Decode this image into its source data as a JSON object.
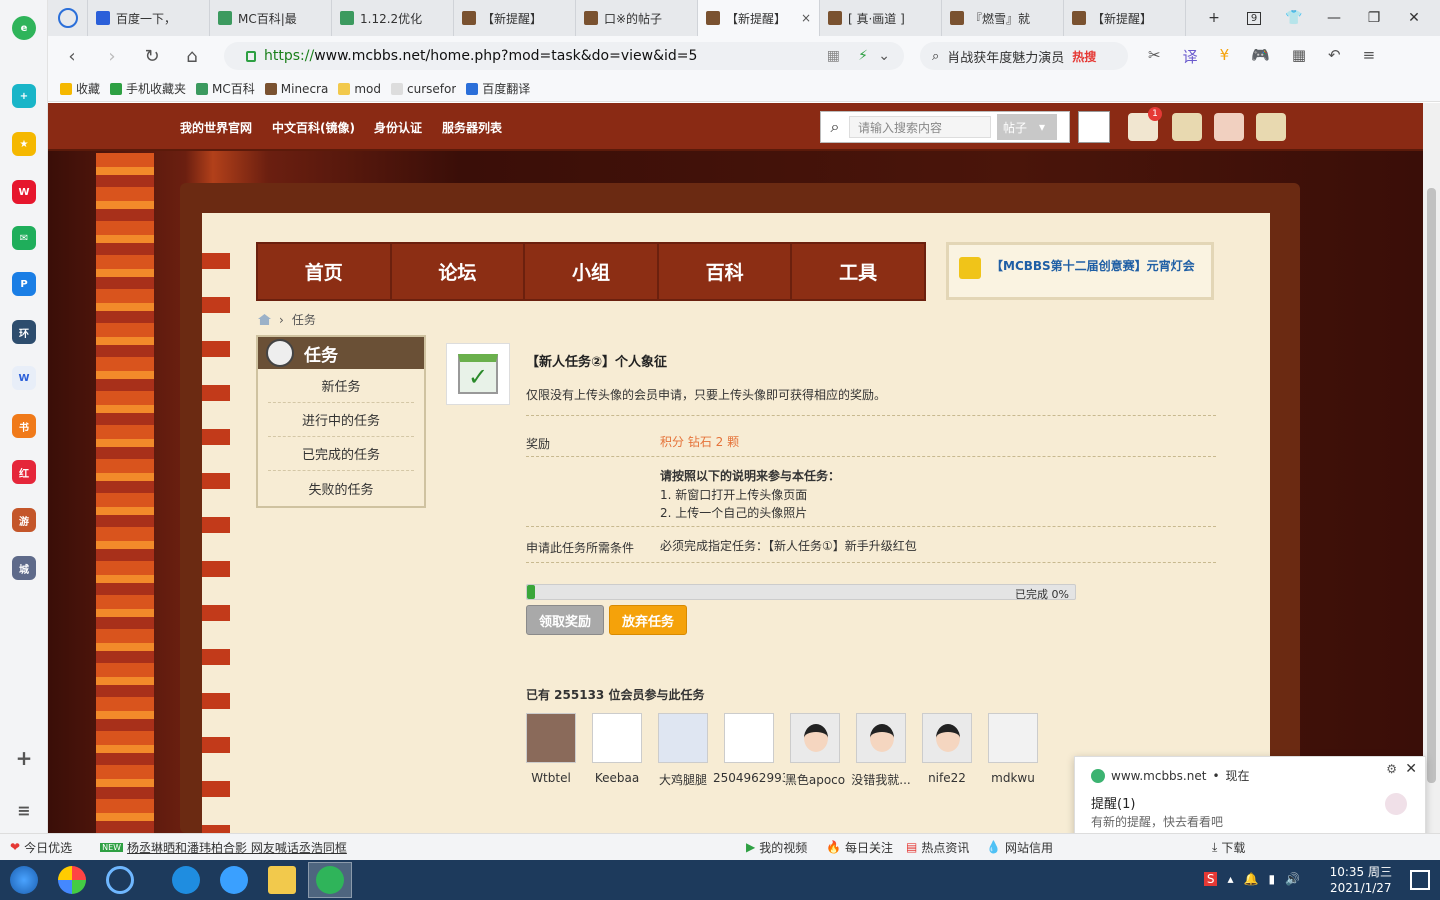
{
  "browser": {
    "tabs": [
      {
        "title": "百度一下，",
        "icon": "baidu-icon",
        "color": "#2b5fd9"
      },
      {
        "title": "MC百科|最",
        "icon": "mc-icon",
        "color": "#3c9a5f"
      },
      {
        "title": "1.12.2优化",
        "icon": "mc-icon",
        "color": "#3c9a5f"
      },
      {
        "title": "【新提醒】",
        "icon": "block-icon",
        "color": "#7a5230"
      },
      {
        "title": "口※的帖子",
        "icon": "block-icon",
        "color": "#7a5230"
      },
      {
        "title": "【新提醒】",
        "icon": "block-icon",
        "color": "#7a5230",
        "active": true
      },
      {
        "title": "[ 真·画道 ]",
        "icon": "block-icon",
        "color": "#7a5230"
      },
      {
        "title": "『燃雪』就",
        "icon": "block-icon",
        "color": "#7a5230"
      },
      {
        "title": "【新提醒】",
        "icon": "block-icon",
        "color": "#7a5230"
      }
    ],
    "tab_close": "×",
    "tab_count": "9",
    "url_scheme": "https://",
    "url_host": "www.mcbbs.net",
    "url_path": "/home.php?mod=task&do=view&id=5",
    "search_text": "肖战获年度魅力演员",
    "search_hot": "热搜",
    "bookmarks": [
      "收藏",
      "手机收藏夹",
      "MC百科",
      "Minecra",
      "mod",
      "cursefor",
      "百度翻译"
    ]
  },
  "site_nav": {
    "links": [
      "我的世界官网",
      "中文百科(镜像)",
      "身份认证",
      "服务器列表"
    ],
    "search_placeholder": "请输入搜索内容",
    "search_type": "帖子",
    "notification_count": "1"
  },
  "main_nav": [
    "首页",
    "论坛",
    "小组",
    "百科",
    "工具"
  ],
  "notice": "【MCBBS第十二届创意赛】元宵灯会",
  "breadcrumb": "任务",
  "task_menu": {
    "title": "任务",
    "items": [
      "新任务",
      "进行中的任务",
      "已完成的任务",
      "失败的任务"
    ]
  },
  "task": {
    "title": "【新人任务②】个人象征",
    "description": "仅限没有上传头像的会员申请，只要上传头像即可获得相应的奖励。",
    "reward_label": "奖励",
    "reward_value": "积分 钻石 2 颗",
    "instructions_title": "请按照以下的说明来参与本任务：",
    "instructions": [
      "1. 新窗口打开上传头像页面",
      "2. 上传一个自己的头像照片"
    ],
    "condition_label": "申请此任务所需条件",
    "condition_value": "必须完成指定任务：【新人任务①】新手升级红包",
    "progress": 0.0,
    "progress_text": "已完成 0%",
    "claim_button": "领取奖励",
    "abandon_button": "放弃任务",
    "members_title": "已有 255133 位会员参与此任务",
    "members": [
      "Wtbtel",
      "Keebaa",
      "大鸡腿腿",
      "2504962993",
      "黑色apoco",
      "没错我就...",
      "nife22",
      "mdkwu"
    ]
  },
  "popup": {
    "source": "www.mcbbs.net",
    "time": "现在",
    "title": "提醒(1)",
    "body": "有新的提醒，快去看看吧"
  },
  "statusbar": {
    "left_items": [
      "今日优选",
      "杨丞琳晒和潘玮柏合影 网友喊话丞浩同框"
    ],
    "right_items": [
      "我的视频",
      "每日关注",
      "热点资讯",
      "网站信用",
      "下载"
    ]
  },
  "taskbar": {
    "time": "10:35 周三",
    "date": "2021/1/27"
  },
  "colors": {
    "nav_red": "#8c2e14",
    "parchment": "#f7ecd4",
    "reward_orange": "#e5733a",
    "button_orange": "#f5a20a",
    "progress_green": "#3aa63a"
  }
}
